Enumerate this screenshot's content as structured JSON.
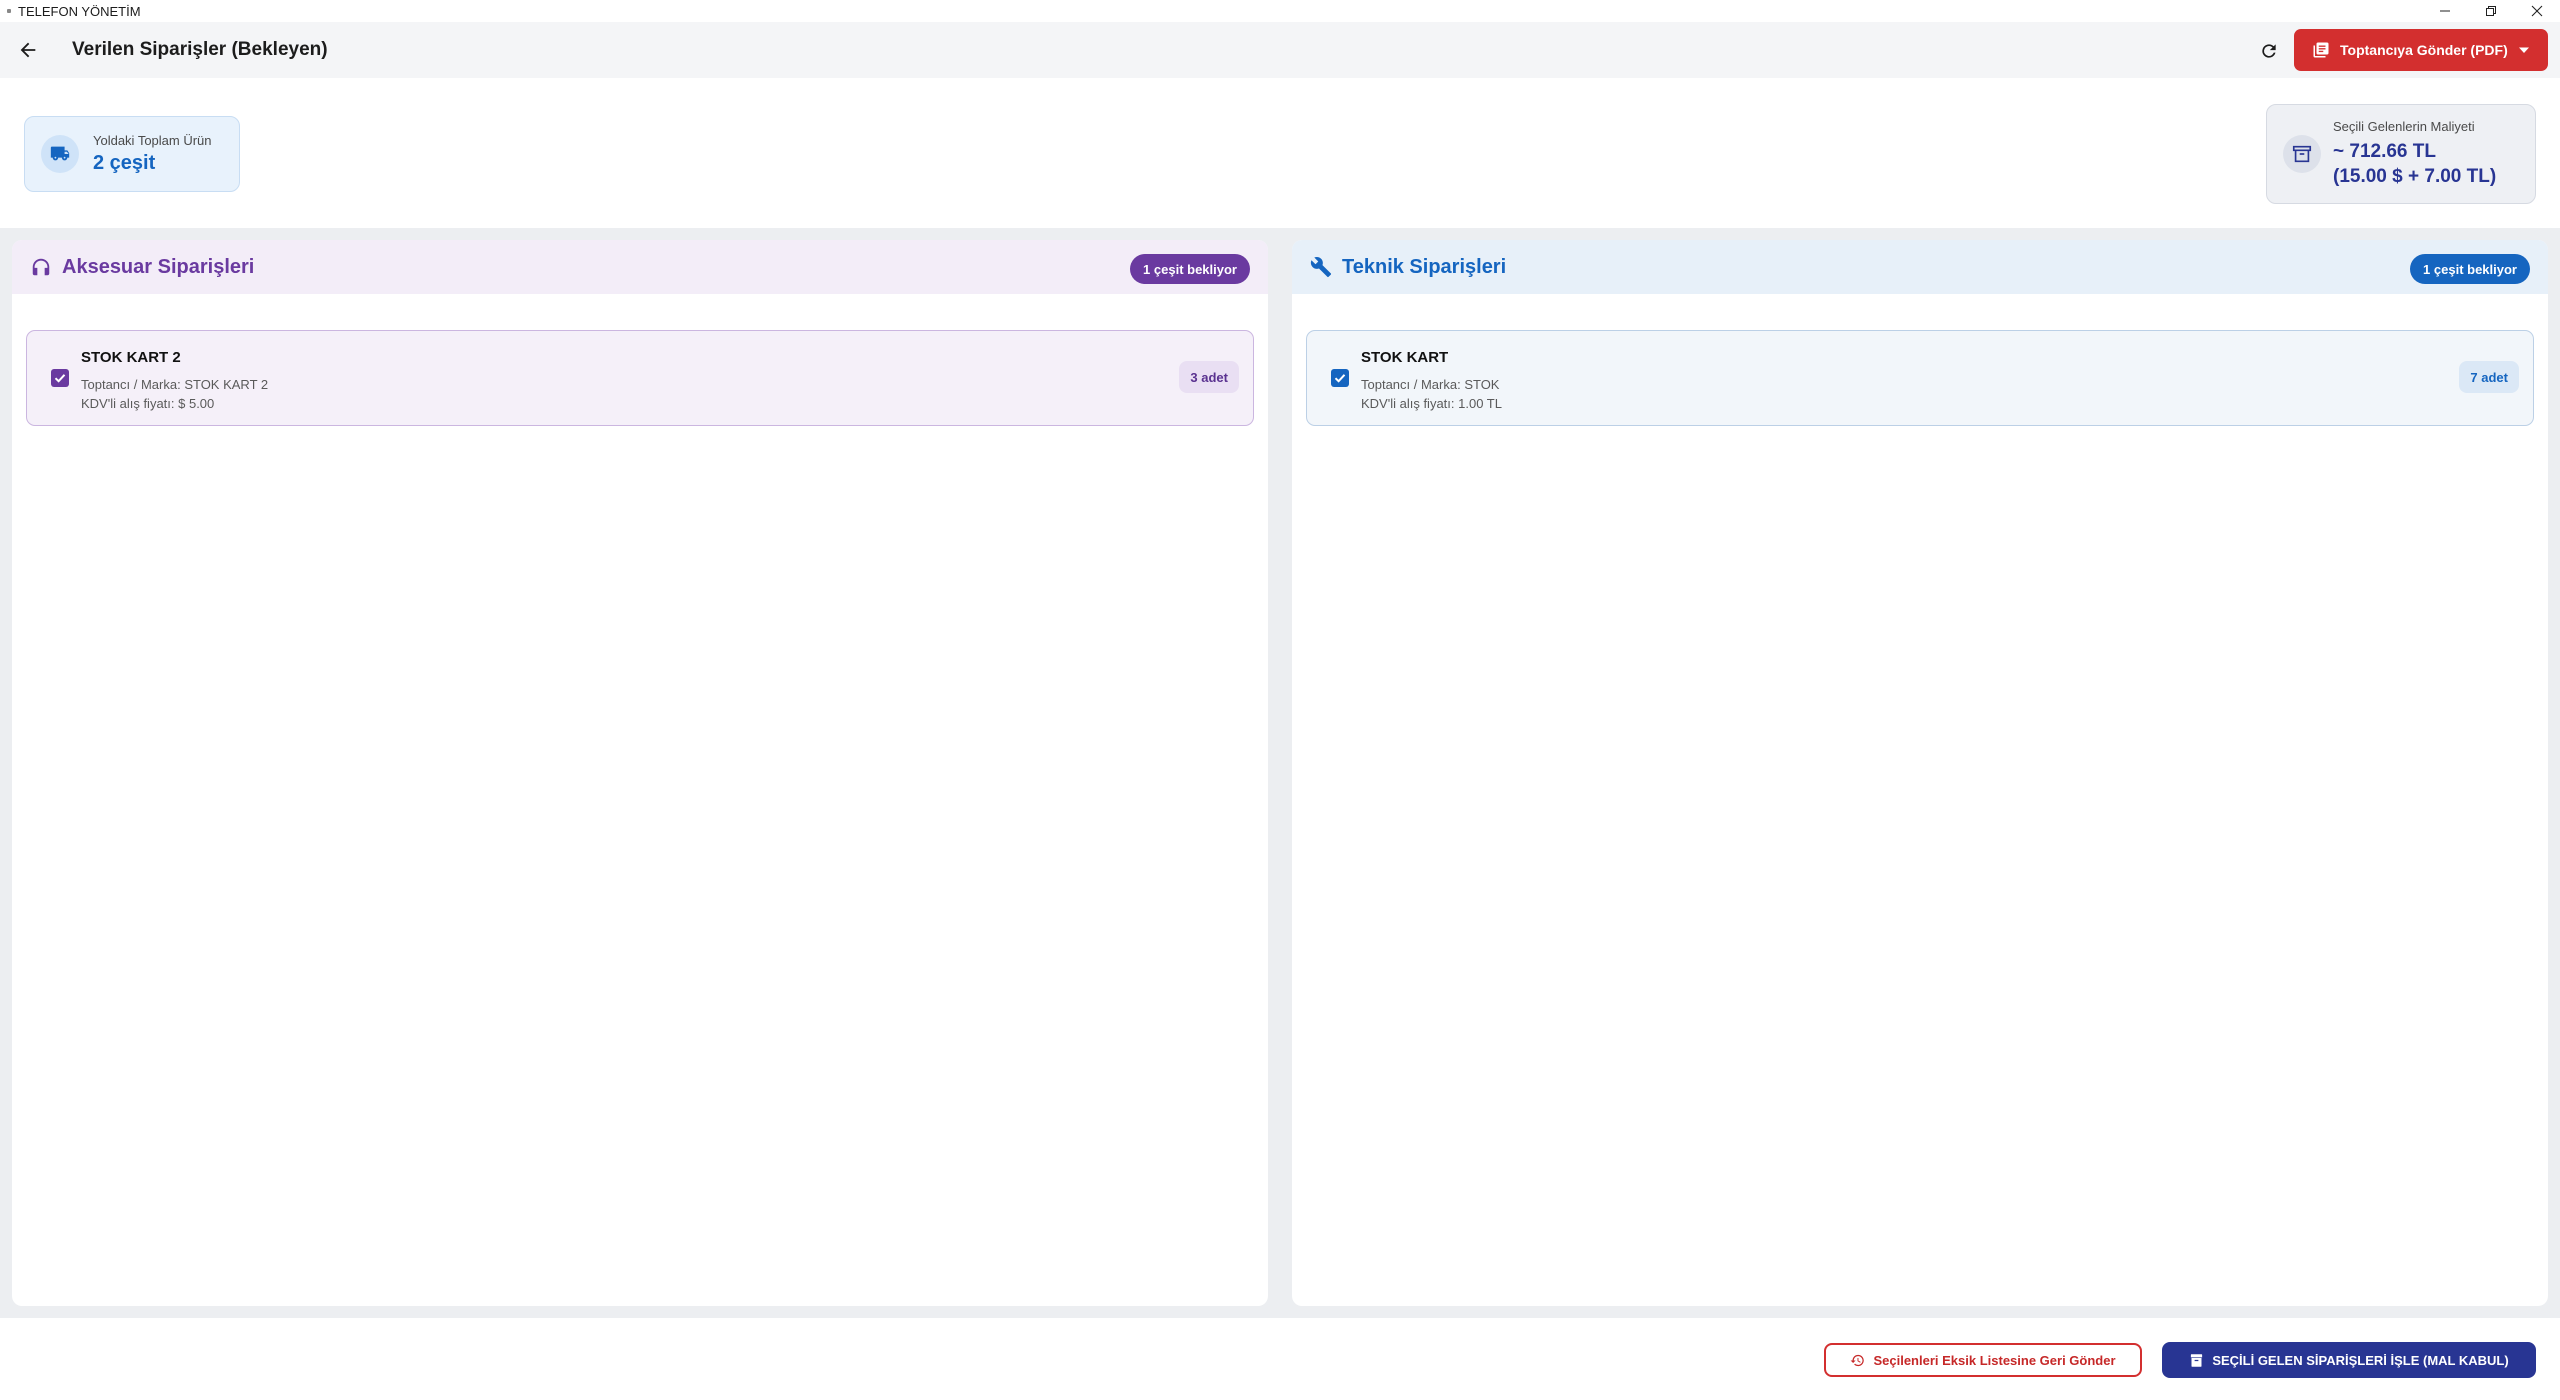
{
  "window": {
    "title": "TELEFON YÖNETİM"
  },
  "appbar": {
    "title": "Verilen Siparişler (Bekleyen)",
    "send_button_label": "Toptancıya Gönder (PDF)"
  },
  "summary": {
    "in_transit_label": "Yoldaki Toplam Ürün",
    "in_transit_value": "2 çeşit",
    "cost_label": "Seçili Gelenlerin Maliyeti",
    "cost_value_line1": "~ 712.66 TL",
    "cost_value_line2": "(15.00 $ + 7.00 TL)"
  },
  "panels": {
    "accessory": {
      "title": "Aksesuar Siparişleri",
      "badge": "1 çeşit bekliyor",
      "color": "#6a3aa0",
      "items": [
        {
          "name": "STOK KART 2",
          "supplier": "Toptancı / Marka: STOK KART 2",
          "price": "KDV'li alış fiyatı: $ 5.00",
          "qty": "3 adet",
          "checked": true
        }
      ]
    },
    "technical": {
      "title": "Teknik Siparişleri",
      "badge": "1 çeşit bekliyor",
      "color": "#1565c0",
      "items": [
        {
          "name": "STOK KART",
          "supplier": "Toptancı / Marka: STOK",
          "price": "KDV'li alış fiyatı: 1.00 TL",
          "qty": "7 adet",
          "checked": true
        }
      ]
    }
  },
  "footer": {
    "return_label": "Seçilenleri Eksik Listesine Geri Gönder",
    "process_label": "SEÇİLİ GELEN SİPARİŞLERİ İŞLE (MAL KABUL)"
  },
  "colors": {
    "danger": "#d32f2f",
    "primary": "#283593",
    "accent_blue": "#1565c0",
    "accent_purple": "#6a3aa0"
  }
}
